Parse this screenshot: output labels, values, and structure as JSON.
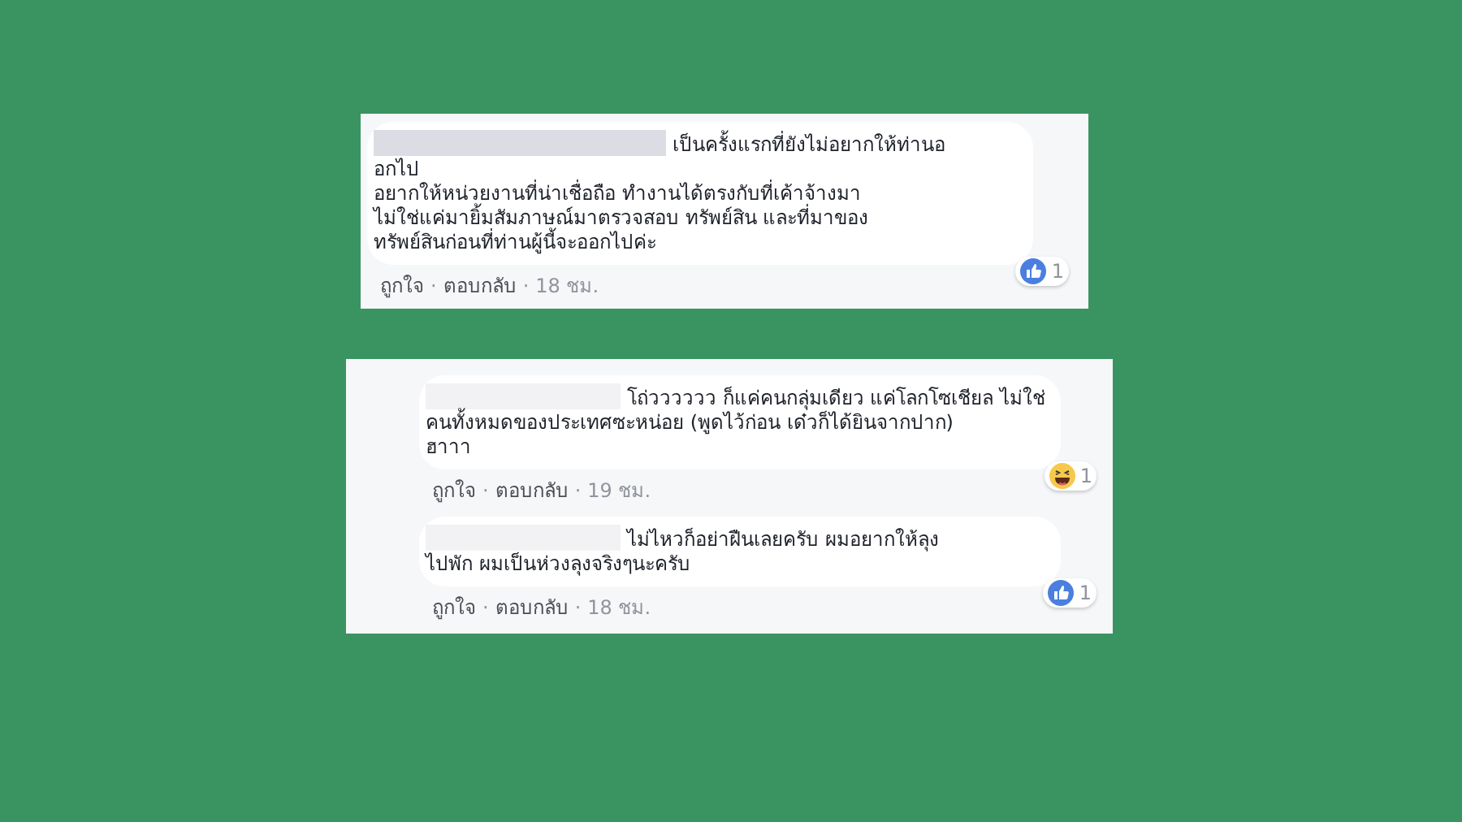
{
  "separator": "·",
  "panels": [
    {
      "comments": [
        {
          "name_redacted": true,
          "lines": [
            "เป็นครั้งแรกที่ยังไม่อยากให้ท่านอ",
            "อกไป",
            "อยากให้หน่วยงานที่น่าเชื่อถือ ทำงานได้ตรงกับที่เค้าจ้างมา",
            "ไม่ใช่แค่มายิ้มสัมภาษณ์มาตรวจสอบ ทรัพย์สิน และที่มาของ",
            "ทรัพย์สินก่อนที่ท่านผู้นี้จะออกไปค่ะ"
          ],
          "reaction": {
            "kind": "like",
            "count": "1"
          },
          "actions": [
            "ถูกใจ",
            "ตอบกลับ"
          ],
          "time": "18 ชม."
        }
      ]
    },
    {
      "comments": [
        {
          "name_redacted": true,
          "lines": [
            "โถ่วววววว ก็แค่คนกลุ่มเดียว แค่โลกโซเชียล ไม่ใช่",
            "คนทั้งหมดของประเทศซะหน่อย (พูดไว้ก่อน เด๋วก็ได้ยินจากปาก)",
            "ฮาาา"
          ],
          "reaction": {
            "kind": "haha",
            "count": "1"
          },
          "actions": [
            "ถูกใจ",
            "ตอบกลับ"
          ],
          "time": "19 ชม."
        },
        {
          "name_redacted": true,
          "lines": [
            "ไม่ไหวก็อย่าฝืนเลยครับ ผมอยากให้ลุง",
            "ไปพัก ผมเป็นห่วงลุงจริงๆนะครับ"
          ],
          "reaction": {
            "kind": "like",
            "count": "1"
          },
          "actions": [
            "ถูกใจ",
            "ตอบกลับ"
          ],
          "time": "18 ชม."
        }
      ]
    }
  ]
}
